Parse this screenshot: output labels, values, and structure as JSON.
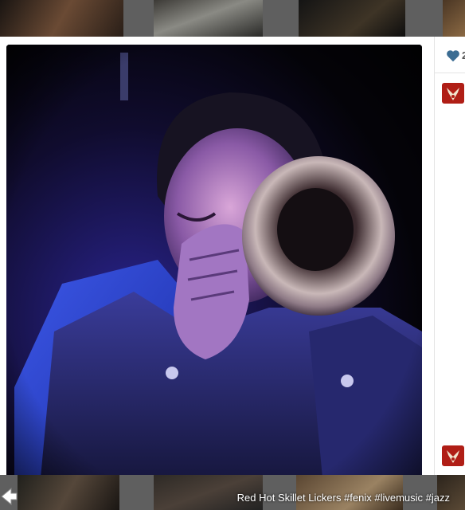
{
  "caption": {
    "text": "Red Hot Skillet Lickers #fenix #livemusic #jazz"
  },
  "likes": {
    "count": "2",
    "icon": "heart-icon",
    "color": "#3b6c92"
  },
  "colors": {
    "avatar": "#b01e16",
    "stage_light": "#4a3fd0"
  },
  "photo": {
    "subject": "trumpet player"
  }
}
